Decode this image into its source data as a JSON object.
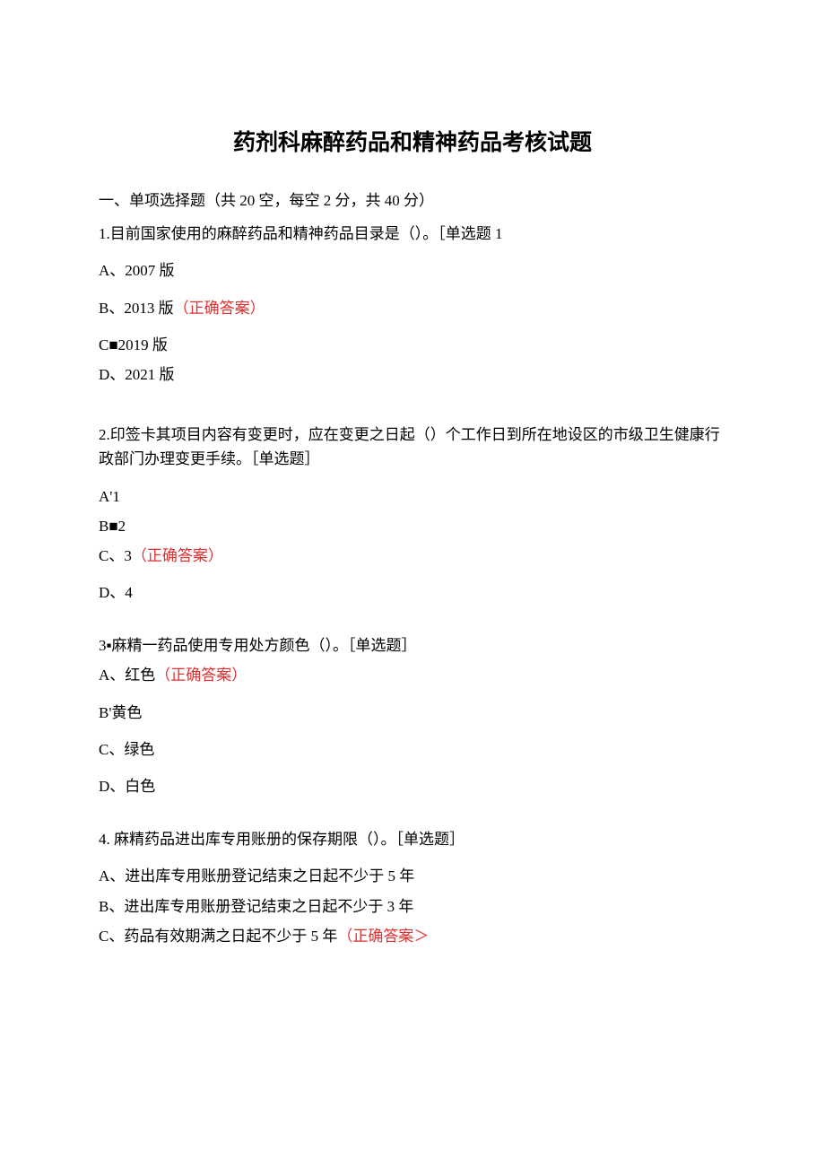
{
  "title": "药剂科麻醉药品和精神药品考核试题",
  "section_header": "一、单项选择题（共 20 空，每空 2 分，共 40 分）",
  "q1": {
    "stem": "1.目前国家使用的麻醉药品和精神药品目录是（）。［单选题 1",
    "a": "A、2007 版",
    "b_prefix": "B、2013 版",
    "b_correct": "（正确答案）",
    "c": "C■2019 版",
    "d": "D、2021 版"
  },
  "q2": {
    "stem": "2.印签卡其项目内容有变更时，应在变更之日起（）个工作日到所在地设区的市级卫生健康行政部门办理变更手续。［单选题］",
    "a": "A'1",
    "b": "B■2",
    "c_prefix": "C、3",
    "c_correct": "（正确答案）",
    "d": "D、4"
  },
  "q3": {
    "stem": "3▪麻精一药品使用专用处方颜色（）。［单选题］",
    "a_prefix": "A、红色",
    "a_correct": "（正确答案）",
    "b": "B'黄色",
    "c": "C、绿色",
    "d": "D、白色"
  },
  "q4": {
    "stem": "4. 麻精药品进出库专用账册的保存期限（）。［单选题］",
    "a": "A、进出库专用账册登记结束之日起不少于 5 年",
    "b": "B、进出库专用账册登记结束之日起不少于 3 年",
    "c_prefix": "C、药品有效期满之日起不少于 5 年",
    "c_correct": "（正确答案＞"
  }
}
